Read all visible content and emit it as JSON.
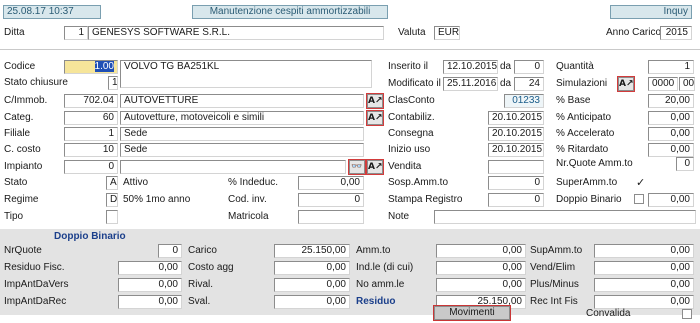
{
  "header": {
    "datetime": "25.08.17 10:37",
    "title": "Manutenzione cespiti ammortizzabili",
    "mode": "Inquy"
  },
  "ditta": {
    "label": "Ditta",
    "code": "1",
    "name": "GENESYS SOFTWARE S.R.L."
  },
  "valuta": {
    "label": "Valuta",
    "value": "EUR"
  },
  "anno_carico": {
    "label": "Anno Carico",
    "value": "2015"
  },
  "codice": {
    "label": "Codice",
    "value": "1.00",
    "description": "VOLVO TG BA251KL"
  },
  "stato_chiusure": {
    "label": "Stato chiusure",
    "value": "1"
  },
  "cimmob": {
    "label": "C/Immob.",
    "code": "702.04",
    "description": "AUTOVETTURE"
  },
  "categ": {
    "label": "Categ.",
    "code": "60",
    "description": "Autovetture, motoveicoli e simili"
  },
  "filiale": {
    "label": "Filiale",
    "code": "1",
    "description": "Sede"
  },
  "c_costo": {
    "label": "C. costo",
    "code": "10",
    "description": "Sede"
  },
  "impianto": {
    "label": "Impianto",
    "code": "0",
    "description": ""
  },
  "stato": {
    "label": "Stato",
    "code": "A",
    "description": "Attivo"
  },
  "regime": {
    "label": "Regime",
    "code": "D",
    "description": "50% 1mo anno"
  },
  "tipo": {
    "label": "Tipo"
  },
  "perc_indeduc": {
    "label": "% Indeduc.",
    "value": "0,00"
  },
  "cod_inv": {
    "label": "Cod. inv.",
    "value": "0"
  },
  "matricola": {
    "label": "Matricola",
    "value": ""
  },
  "inserito": {
    "label": "Inserito il",
    "date": "12.10.2015",
    "da_label": "da",
    "da_value": "0"
  },
  "modificato": {
    "label": "Modificato il",
    "date": "25.11.2016",
    "da_label": "da",
    "da_value": "24"
  },
  "clasconto": {
    "label": "ClasConto",
    "value": "01233"
  },
  "contabiliz": {
    "label": "Contabiliz.",
    "value": "20.10.2015"
  },
  "consegna": {
    "label": "Consegna",
    "value": "20.10.2015"
  },
  "inizio_uso": {
    "label": "Inizio uso",
    "value": "20.10.2015"
  },
  "vendita": {
    "label": "Vendita",
    "value": ""
  },
  "sosp_amm": {
    "label": "Sosp.Amm.to",
    "value": "0"
  },
  "stampa_registro": {
    "label": "Stampa Registro",
    "value": "0"
  },
  "note": {
    "label": "Note",
    "value": ""
  },
  "quantita": {
    "label": "Quantità",
    "value": "1"
  },
  "simulazioni": {
    "label": "Simulazioni",
    "value1": "0000",
    "value2": "00"
  },
  "perc_base": {
    "label": "% Base",
    "value": "20,00"
  },
  "perc_anticipato": {
    "label": "% Anticipato",
    "value": "0,00"
  },
  "perc_accelerato": {
    "label": "% Accelerato",
    "value": "0,00"
  },
  "perc_ritardato": {
    "label": "% Ritardato",
    "value": "0,00"
  },
  "nr_quote": {
    "label": "Nr.Quote Amm.to",
    "value": "0"
  },
  "super_amm": {
    "label": "SuperAmm.to",
    "checked": "✓"
  },
  "doppio_binario_flag": {
    "label": "Doppio Binario",
    "value": "0,00"
  },
  "doppio_binario": {
    "title": "Doppio Binario",
    "nrquote_label": "NrQuote",
    "nrquote": "0",
    "residuo_fisc_label": "Residuo Fisc.",
    "residuo_fisc": "0,00",
    "impantdavers_label": "ImpAntDaVers",
    "impantdavers": "0,00",
    "impantdarec_label": "ImpAntDaRec",
    "impantdarec": "0,00"
  },
  "values": {
    "carico_label": "Carico",
    "carico": "25.150,00",
    "costo_agg_label": "Costo agg",
    "costo_agg": "0,00",
    "rival_label": "Rival.",
    "rival": "0,00",
    "sval_label": "Sval.",
    "sval": "0,00",
    "ammto_label": "Amm.to",
    "ammto": "0,00",
    "indle_label": "Ind.le (di cui)",
    "indle": "0,00",
    "no_amm_label": "No amm.le",
    "no_amm": "0,00",
    "residuo_label": "Residuo",
    "residuo": "25.150,00",
    "supammto_label": "SupAmm.to",
    "supammto": "0,00",
    "vendelim_label": "Vend/Elim",
    "vendelim": "0,00",
    "plusminus_label": "Plus/Minus",
    "plusminus": "0,00",
    "recintfis_label": "Rec Int Fis",
    "recintfis": "0,00"
  },
  "buttons": {
    "movimenti": "Movimenti",
    "lookup_glyph": "A↗",
    "binoculars_glyph": "👓"
  },
  "convalida": {
    "label": "Convalida"
  }
}
